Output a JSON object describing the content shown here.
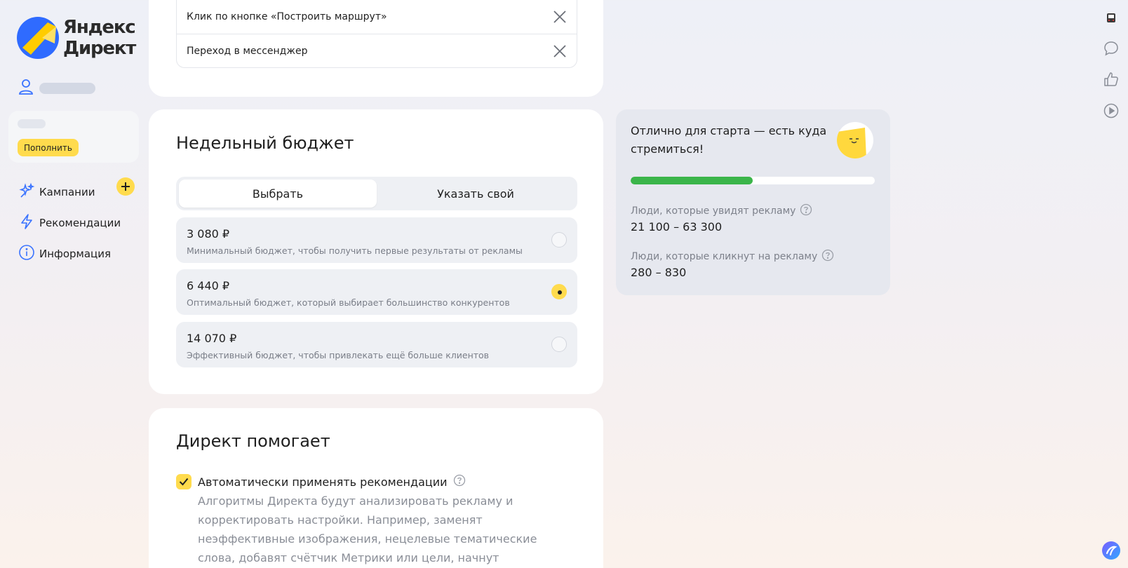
{
  "brand": {
    "line1": "Яндекс",
    "line2": "Директ"
  },
  "sidebar": {
    "topup_label": "Пополнить",
    "items": [
      {
        "label": "Кампании",
        "icon": "campaigns-sparkle-icon"
      },
      {
        "label": "Рекомендации",
        "icon": "lightning-icon"
      },
      {
        "label": "Информация",
        "icon": "info-icon"
      }
    ]
  },
  "goals": [
    {
      "label": "Клик по кнопке «Построить маршрут»"
    },
    {
      "label": "Переход в мессенджер"
    }
  ],
  "budget": {
    "title": "Недельный бюджет",
    "tabs": [
      {
        "label": "Выбрать",
        "active": true
      },
      {
        "label": "Указать свой",
        "active": false
      }
    ],
    "options": [
      {
        "amount": "3 080 ₽",
        "description": "Минимальный бюджет, чтобы получить первые результаты от рекламы",
        "selected": false
      },
      {
        "amount": "6 440 ₽",
        "description": "Оптимальный бюджет, который выбирает большинство конкурентов",
        "selected": true
      },
      {
        "amount": "14 070 ₽",
        "description": "Эффективный бюджет, чтобы привлекать ещё больше клиентов",
        "selected": false
      }
    ]
  },
  "forecast": {
    "headline": "Отлично для старта — есть куда стремиться!",
    "progress": 0.5,
    "reach_label": "Люди, которые увидят рекламу",
    "reach_value": "21 100 – 63 300",
    "clicks_label": "Люди, которые кликнут на рекламу",
    "clicks_value": "280 – 830"
  },
  "help": {
    "title": "Директ помогает",
    "auto_apply_label": "Автоматически применять рекомендации",
    "auto_apply_checked": true,
    "description": "Алгоритмы Директа будут анализировать рекламу и корректировать настройки. Например, заменят неэффективные изображения, нецелевые тематические слова, добавят счётчик Метрики или цели, начнут продвигать вашу"
  },
  "right_rail": [
    "app-widget-icon",
    "chat-bubble-icon",
    "thumbs-up-icon",
    "play-circle-icon",
    "alice-assistant-icon"
  ],
  "colors": {
    "accent_yellow": "#ffdb4d",
    "progress_green": "#3bb54a",
    "brand_blue": "#2f6bff"
  }
}
